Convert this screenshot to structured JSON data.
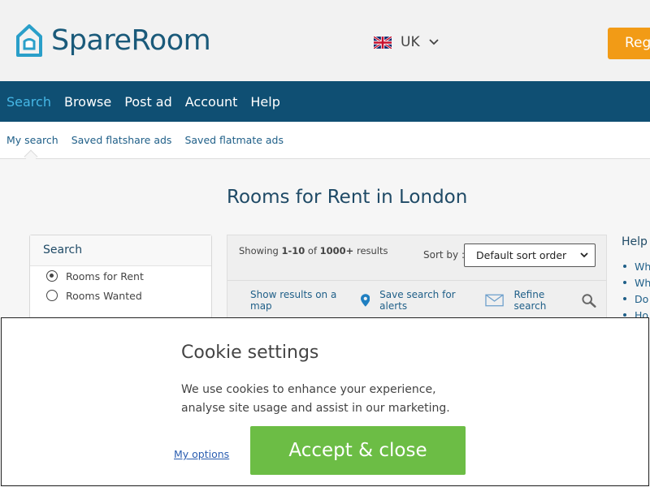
{
  "header": {
    "logo_text": "SpareRoom",
    "country": "UK",
    "register_label": "Register"
  },
  "mainnav": {
    "items": [
      {
        "label": "Search"
      },
      {
        "label": "Browse"
      },
      {
        "label": "Post ad"
      },
      {
        "label": "Account"
      },
      {
        "label": "Help"
      }
    ]
  },
  "subnav": {
    "items": [
      {
        "label": "My search"
      },
      {
        "label": "Saved flatshare ads"
      },
      {
        "label": "Saved flatmate ads"
      }
    ]
  },
  "page": {
    "title": "Rooms for Rent in London"
  },
  "search_box": {
    "title": "Search",
    "options": [
      {
        "label": "Rooms for Rent",
        "checked": true
      },
      {
        "label": "Rooms Wanted",
        "checked": false
      }
    ]
  },
  "results": {
    "showing_prefix": "Showing ",
    "showing_range": "1-10",
    "showing_of": " of ",
    "showing_total": "1000+",
    "showing_suffix": " results",
    "sort_label": "Sort by :",
    "sort_value": "Default sort order",
    "actions": {
      "map": "Show results on a map",
      "alerts": "Save search for alerts",
      "refine": "Refine search"
    }
  },
  "help": {
    "title": "Help",
    "links": [
      "Wh",
      "Wh",
      "Do",
      "Ho"
    ]
  },
  "cookie": {
    "title": "Cookie settings",
    "text": "We use cookies to enhance your experience, analyse site usage and assist in our marketing.",
    "options_label": "My options",
    "accept_label": "Accept & close"
  },
  "colors": {
    "nav_bg": "#0f4f73",
    "nav_active": "#46b7e6",
    "register": "#f29b16",
    "accept": "#6cbd45"
  }
}
